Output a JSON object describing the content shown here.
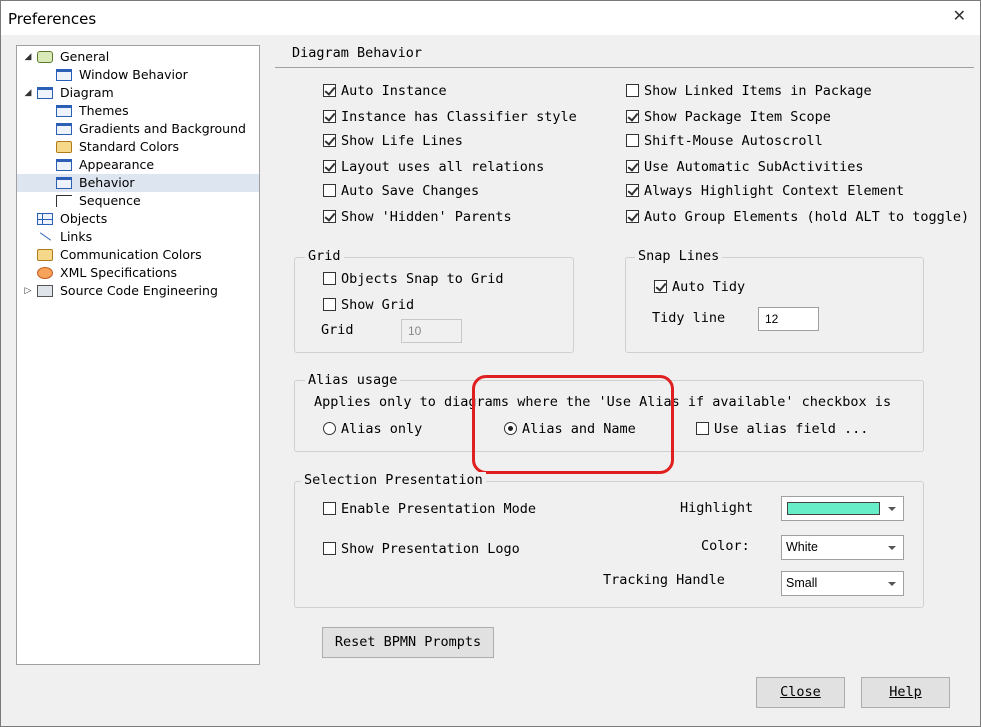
{
  "window": {
    "title": "Preferences",
    "close_glyph": "✕"
  },
  "tree": {
    "items": [
      {
        "label": "General",
        "icon": "gear-icon",
        "expander": "◢",
        "level": 0
      },
      {
        "label": "Window Behavior",
        "icon": "window-icon",
        "level": 1
      },
      {
        "label": "Diagram",
        "icon": "diagram-icon",
        "expander": "◢",
        "level": 0
      },
      {
        "label": "Themes",
        "icon": "window-icon",
        "level": 1
      },
      {
        "label": "Gradients and Background",
        "icon": "window-icon",
        "level": 1
      },
      {
        "label": "Standard Colors",
        "icon": "palette-icon",
        "level": 1
      },
      {
        "label": "Appearance",
        "icon": "window-icon",
        "level": 1
      },
      {
        "label": "Behavior",
        "icon": "window-icon",
        "level": 1,
        "selected": true
      },
      {
        "label": "Sequence",
        "icon": "sequence-icon",
        "level": 1
      },
      {
        "label": "Objects",
        "icon": "objects-icon",
        "level": 0
      },
      {
        "label": "Links",
        "icon": "links-icon",
        "level": 0
      },
      {
        "label": "Communication Colors",
        "icon": "communication-icon",
        "level": 0
      },
      {
        "label": "XML Specifications",
        "icon": "xml-icon",
        "level": 0
      },
      {
        "label": "Source Code Engineering",
        "icon": "code-icon",
        "expander": "▷",
        "level": 0
      }
    ]
  },
  "section_title": "Diagram Behavior",
  "left_options": [
    {
      "label": "Auto Instance",
      "checked": true
    },
    {
      "label": "Instance has Classifier style",
      "checked": true
    },
    {
      "label": "Show Life Lines",
      "checked": true
    },
    {
      "label": "Layout uses all relations",
      "checked": true
    },
    {
      "label": "Auto Save Changes",
      "checked": false
    },
    {
      "label": "Show 'Hidden' Parents",
      "checked": true
    }
  ],
  "right_options": [
    {
      "label": "Show Linked Items in Package",
      "checked": false
    },
    {
      "label": "Show Package Item Scope",
      "checked": true
    },
    {
      "label": "Shift-Mouse Autoscroll",
      "checked": false
    },
    {
      "label": "Use Automatic SubActivities",
      "checked": true
    },
    {
      "label": "Always Highlight Context Element",
      "checked": true
    },
    {
      "label": "Auto Group Elements (hold ALT to toggle)",
      "checked": true
    }
  ],
  "grid": {
    "title": "Grid",
    "snap_label": "Objects Snap to Grid",
    "snap_checked": false,
    "show_label": "Show Grid",
    "show_checked": false,
    "size_label": "Grid",
    "size_value": "10"
  },
  "snap_lines": {
    "title": "Snap Lines",
    "auto_tidy_label": "Auto Tidy",
    "auto_tidy_checked": true,
    "tidy_line_label": "Tidy line",
    "tidy_line_value": "12"
  },
  "alias": {
    "title": "Alias usage",
    "description": "Applies only to diagrams where the 'Use Alias if available' checkbox is",
    "option_alias_only": "Alias only",
    "option_alias_and_name": "Alias and Name",
    "selected": "Alias and Name",
    "use_alias_field_label": "Use alias field ...",
    "use_alias_field_checked": false
  },
  "selection": {
    "title": "Selection Presentation",
    "enable_label": "Enable Presentation Mode",
    "enable_checked": false,
    "logo_label": "Show Presentation Logo",
    "logo_checked": false,
    "highlight_label": "Highlight",
    "highlight_color": "#66eec8",
    "color_label": "Color:",
    "color_value": "White",
    "tracking_label": "Tracking Handle",
    "tracking_value": "Small"
  },
  "buttons": {
    "reset": "Reset BPMN Prompts",
    "close": "Close",
    "help": "Help"
  },
  "colors": {
    "annotation_ring": "#e02020",
    "selection_bg": "#dde6f0"
  }
}
